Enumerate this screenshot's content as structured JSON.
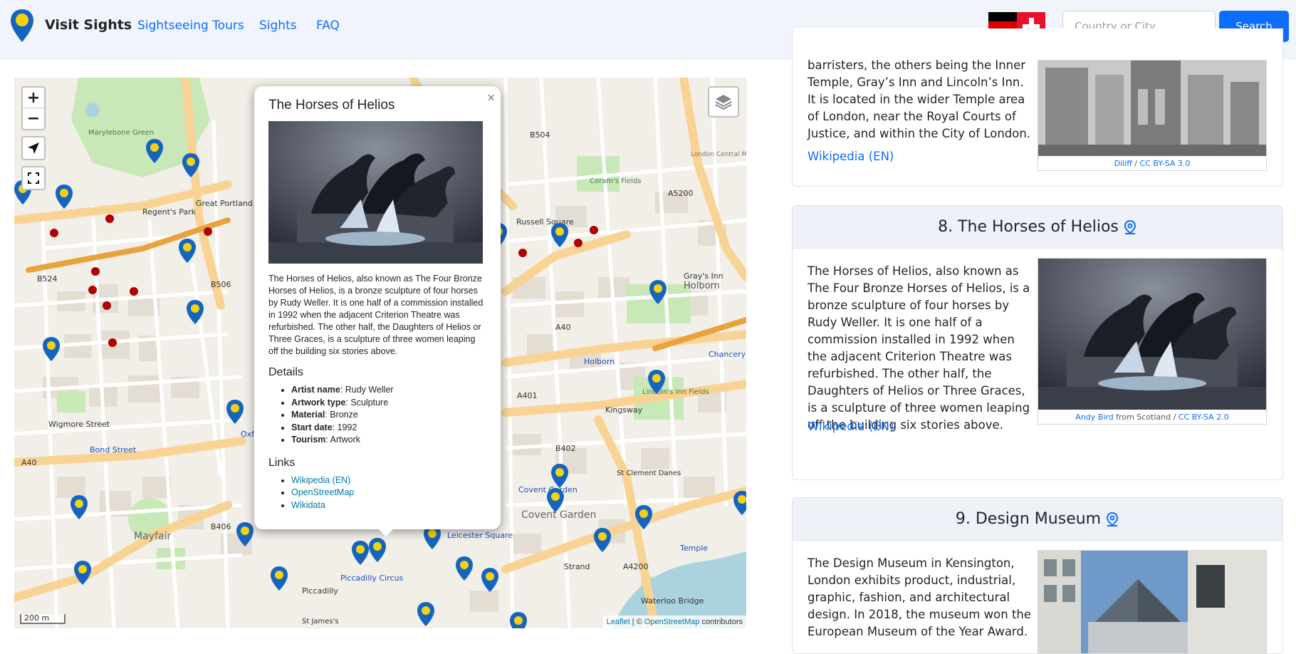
{
  "navbar": {
    "brand": "Visit Sights",
    "links": [
      "Sightseeing Tours",
      "Sights",
      "FAQ"
    ],
    "search_placeholder": "Country or City",
    "search_button": "Search"
  },
  "map": {
    "scale": "200 m",
    "attribution": {
      "leaflet": "Leaflet",
      "sep": " | © ",
      "osm": "OpenStreetMap",
      "suffix": " contributors"
    },
    "labels": [
      {
        "name": "label-regents-park",
        "text": "Regent's Park"
      },
      {
        "name": "label-great-portland-street",
        "text": "Great Portland Street"
      },
      {
        "name": "label-russell-square",
        "text": "Russell Square"
      },
      {
        "name": "label-corams-fields",
        "text": "Coram's Fields"
      },
      {
        "name": "label-holborn",
        "text": "Holborn"
      },
      {
        "name": "label-holborn-station",
        "text": "Holborn"
      },
      {
        "name": "label-lincolns-inn-fields",
        "text": "Lincoln's Inn Fields"
      },
      {
        "name": "label-chancery-lane",
        "text": "Chancery Lane"
      },
      {
        "name": "label-bond-street",
        "text": "Bond Street"
      },
      {
        "name": "label-mayfair",
        "text": "Mayfair"
      },
      {
        "name": "label-covent-garden",
        "text": "Covent Garden"
      },
      {
        "name": "label-covent-garden-station",
        "text": "Covent Garden"
      },
      {
        "name": "label-piccadilly-circus",
        "text": "Piccadilly Circus"
      },
      {
        "name": "label-leicester-square",
        "text": "Leicester Square"
      },
      {
        "name": "label-temple",
        "text": "Temple"
      },
      {
        "name": "label-waterloo-bridge",
        "text": "Waterloo Bridge"
      },
      {
        "name": "label-strand",
        "text": "Strand"
      },
      {
        "name": "label-kingsway",
        "text": "Kingsway"
      },
      {
        "name": "label-a40",
        "text": "A40"
      },
      {
        "name": "label-a401",
        "text": "A401"
      },
      {
        "name": "label-a4200",
        "text": "A4200"
      },
      {
        "name": "label-a5200",
        "text": "A5200"
      },
      {
        "name": "label-b504",
        "text": "B504"
      },
      {
        "name": "label-b506",
        "text": "B506"
      },
      {
        "name": "label-b524",
        "text": "B524"
      },
      {
        "name": "label-b402",
        "text": "B402"
      },
      {
        "name": "label-b406",
        "text": "B406"
      },
      {
        "name": "label-a40-west",
        "text": "A40"
      },
      {
        "name": "label-wigmore-street",
        "text": "Wigmore Street"
      },
      {
        "name": "label-piccadilly",
        "text": "Piccadilly"
      },
      {
        "name": "label-grays-inn",
        "text": "Gray's Inn"
      },
      {
        "name": "label-st-clement-danes",
        "text": "St Clement Danes"
      },
      {
        "name": "label-marylebone-green",
        "text": "Marylebone Green"
      },
      {
        "name": "label-oxford-circus",
        "text": "Oxf Circ"
      },
      {
        "name": "label-st-jamess",
        "text": "St James's"
      },
      {
        "name": "label-london-central-mail",
        "text": "London Central Mail Centre"
      }
    ]
  },
  "popup": {
    "close": "×",
    "title": "The Horses of Helios",
    "description": "The Horses of Helios, also known as The Four Bronze Horses of Helios, is a bronze sculpture of four horses by Rudy Weller. It is one half of a commission installed in 1992 when the adjacent Criterion Theatre was refurbished. The other half, the Daughters of Helios or Three Graces, is a sculpture of three women leaping off the building six stories above.",
    "details_heading": "Details",
    "details": [
      {
        "key": "Artist name",
        "value": ": Rudy Weller"
      },
      {
        "key": "Artwork type",
        "value": ": Sculpture"
      },
      {
        "key": "Material",
        "value": ": Bronze"
      },
      {
        "key": "Start date",
        "value": ": 1992"
      },
      {
        "key": "Tourism",
        "value": ": Artwork"
      }
    ],
    "links_heading": "Links",
    "links": [
      "Wikipedia (EN)",
      "OpenStreetMap",
      "Wikidata"
    ]
  },
  "cards": [
    {
      "text": "barristers, the others being the Inner Temple, Gray’s Inn and Lincoln’s Inn. It is located in the wider Temple area of London, near the Royal Courts of Justice, and within the City of London.",
      "link": "Wikipedia (EN)",
      "caption_author": "Diliff",
      "caption_sep": " / ",
      "caption_license": "CC BY-SA 3.0"
    },
    {
      "title": "8. The Horses of Helios",
      "text": "The Horses of Helios, also known as The Four Bronze Horses of Helios, is a bronze sculpture of four horses by Rudy Weller. It is one half of a commission installed in 1992 when the adjacent Criterion Theatre was refurbished. The other half, the Daughters of Helios or Three Graces, is a sculpture of three women leaping off the building six stories above.",
      "link": "Wikipedia (EN)",
      "caption_author": "Andy Bird",
      "caption_from": " from Scotland / ",
      "caption_license": "CC BY-SA 2.0"
    },
    {
      "title": "9. Design Museum",
      "text": "The Design Museum in Kensington, London exhibits product, industrial, graphic, fashion, and architectural design. In 2018, the museum won the European Museum of the Year Award."
    }
  ],
  "colors": {
    "primary": "#0d6efd",
    "marker": "#1565c0",
    "marker_dot": "#f5d20b",
    "poi": "#b00000",
    "park": "#c8e8b8",
    "major_road": "#f8d394",
    "water": "#aad3df"
  }
}
